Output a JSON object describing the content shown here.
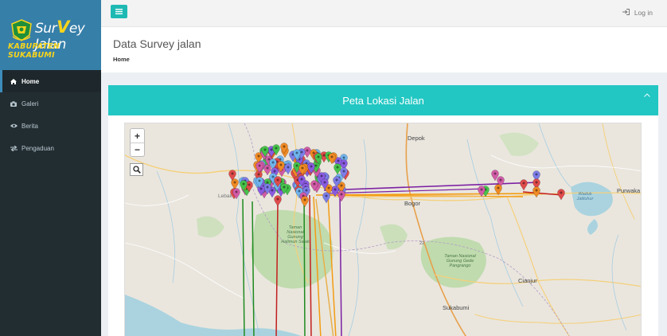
{
  "sidebar": {
    "logo": {
      "title_pre": "Sur",
      "title_v": "V",
      "title_post": "ey Jalan",
      "subtitle": "KABUPATEN SUKABUMI"
    },
    "items": [
      {
        "label": "Home",
        "icon": "home-icon",
        "active": true
      },
      {
        "label": "Galeri",
        "icon": "camera-icon"
      },
      {
        "label": "Berita",
        "icon": "eye-icon"
      },
      {
        "label": "Pengaduan",
        "icon": "exchange-icon"
      }
    ]
  },
  "header": {
    "login_label": "Log in",
    "toggle_icon": "menu-icon"
  },
  "content": {
    "title": "Data Survey jalan",
    "breadcrumb": "Home"
  },
  "panel": {
    "title": "Peta Lokasi Jalan",
    "collapse_icon": "chevron-up-icon"
  },
  "map": {
    "zoom_in": "+",
    "zoom_out": "−",
    "towns": [
      "Depok",
      "Bogor",
      "Cianjur",
      "Sukabumi",
      "Purwaka",
      "Lebak"
    ],
    "park_labels": [
      "Taman Nasional Gunung Halimun Salak",
      "Taman Nasional Gunung Gede Pangrango"
    ],
    "small_labels": [
      "Waduk Jatiluhur",
      "22"
    ],
    "marker_colors": [
      "#e04b4b",
      "#46c24a",
      "#8a5be0",
      "#f08a24",
      "#7d7de8",
      "#d15ba7",
      "#6fb4ee"
    ],
    "line_colors": [
      "#1e8a1e",
      "#c21e1e",
      "#7b1fa2",
      "#f39c12",
      "#e8b04a"
    ]
  }
}
